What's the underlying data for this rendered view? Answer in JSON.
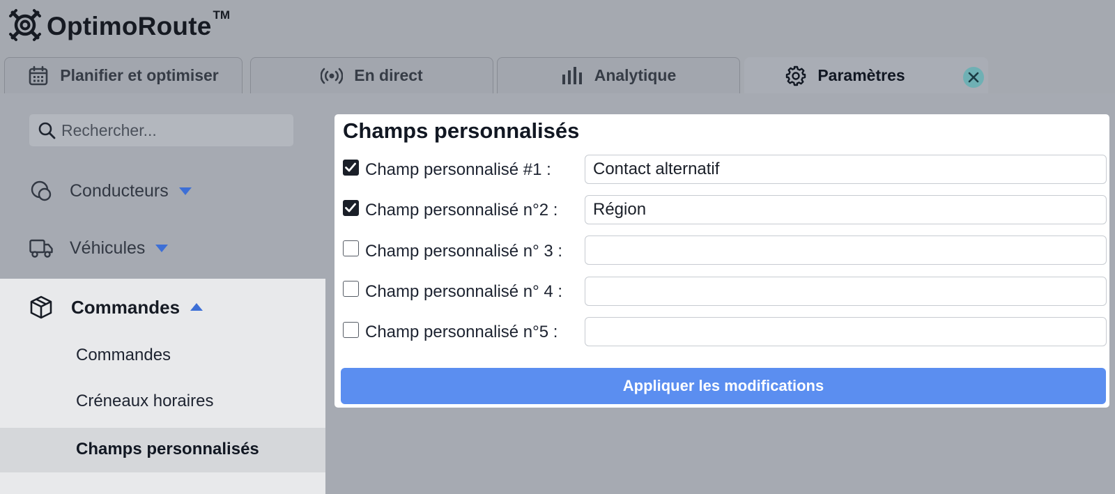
{
  "app": {
    "logo_text": "OptimoRoute",
    "logo_tm": "TM"
  },
  "tabs": [
    {
      "label": "Planifier et optimiser",
      "icon": "calendar-icon",
      "active": false
    },
    {
      "label": "En direct",
      "icon": "broadcast-icon",
      "active": false
    },
    {
      "label": "Analytique",
      "icon": "bar-chart-icon",
      "active": false
    },
    {
      "label": "Paramètres",
      "icon": "gear-icon",
      "active": true
    }
  ],
  "sidebar": {
    "search_placeholder": "Rechercher...",
    "items": [
      {
        "label": "Conducteurs",
        "icon": "drivers-icon",
        "expanded": false
      },
      {
        "label": "Véhicules",
        "icon": "truck-icon",
        "expanded": false
      },
      {
        "label": "Commandes",
        "icon": "box-icon",
        "expanded": true
      }
    ],
    "sub_items": [
      {
        "label": "Commandes",
        "selected": false
      },
      {
        "label": "Créneaux horaires",
        "selected": false
      },
      {
        "label": "Champs personnalisés",
        "selected": true
      }
    ]
  },
  "main": {
    "title": "Champs personnalisés",
    "fields": [
      {
        "label": "Champ personnalisé #1 :",
        "checked": true,
        "value": "Contact alternatif"
      },
      {
        "label": "Champ personnalisé n°2 :",
        "checked": true,
        "value": "Région"
      },
      {
        "label": "Champ personnalisé n° 3 :",
        "checked": false,
        "value": ""
      },
      {
        "label": "Champ personnalisé n° 4 :",
        "checked": false,
        "value": ""
      },
      {
        "label": "Champ personnalisé n°5 :",
        "checked": false,
        "value": ""
      }
    ],
    "apply_label": "Appliquer les modifications"
  },
  "colors": {
    "accent": "#5b8ef0",
    "close_badge": "#6fb0b4",
    "background": "#a6aab2",
    "card": "#ffffff"
  }
}
